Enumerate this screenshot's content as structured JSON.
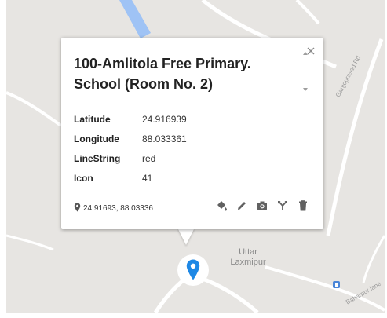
{
  "map": {
    "town_label_line1": "Uttar",
    "town_label_line2": "Laxmipur",
    "road_label_1": "Ganjoprasad Rd",
    "road_label_2": "Baharpur lane",
    "colors": {
      "background": "#e7e5e2",
      "road": "#ffffff",
      "water": "#9fc3f5",
      "marker": "#1e88e5"
    }
  },
  "popup": {
    "title": "100-Amlitola Free Primary. School (Room No. 2)",
    "close_icon": "close-icon",
    "properties": [
      {
        "key": "Latitude",
        "value": "24.916939"
      },
      {
        "key": "Longitude",
        "value": "88.033361"
      },
      {
        "key": "LineString",
        "value": "red"
      },
      {
        "key": "Icon",
        "value": "41"
      }
    ],
    "coordinates": "24.91693, 88.03336",
    "toolbar_icons": [
      "paint-bucket-icon",
      "pencil-icon",
      "camera-icon",
      "directions-icon",
      "trash-icon"
    ]
  }
}
